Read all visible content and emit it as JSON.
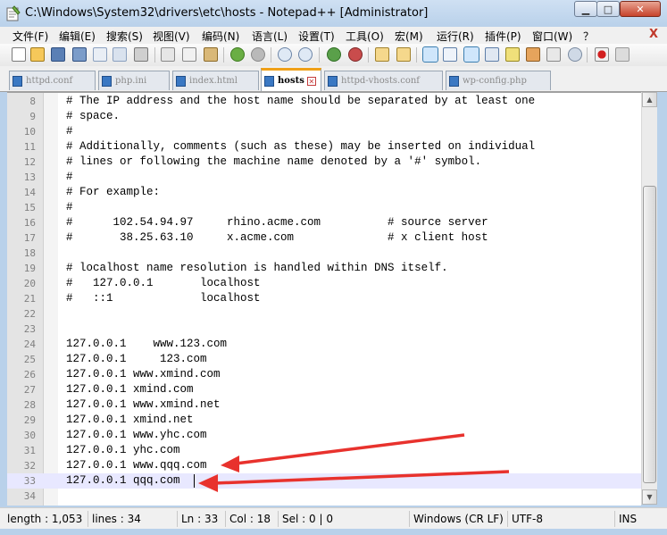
{
  "window": {
    "title": "C:\\Windows\\System32\\drivers\\etc\\hosts - Notepad++ [Administrator]",
    "minimize_glyph": "▁",
    "maximize_glyph": "□",
    "close_glyph": "✕"
  },
  "menu": {
    "items": [
      "文件(F)",
      "编辑(E)",
      "搜索(S)",
      "视图(V)",
      "编码(N)",
      "语言(L)",
      "设置(T)",
      "工具(O)",
      "宏(M)",
      "运行(R)",
      "插件(P)",
      "窗口(W)",
      "？"
    ],
    "close_glyph": "X"
  },
  "toolbar": {
    "icons": [
      "new-file-icon",
      "open-file-icon",
      "save-icon",
      "save-all-icon",
      "close-icon",
      "close-all-icon",
      "print-icon",
      "cut-icon",
      "copy-icon",
      "paste-icon",
      "undo-icon",
      "redo-icon",
      "find-icon",
      "replace-icon",
      "zoom-in-icon",
      "zoom-out-icon",
      "sync-vertical-icon",
      "sync-horizontal-icon",
      "word-wrap-icon",
      "show-all-chars-icon",
      "indent-guide-icon",
      "doc-map-icon",
      "function-list-icon",
      "folder-workspace-icon",
      "monitor-icon",
      "record-macro-icon",
      "stop-record-icon"
    ]
  },
  "tabs": [
    {
      "label": "httpd.conf",
      "active": false
    },
    {
      "label": "php.ini",
      "active": false
    },
    {
      "label": "index.html",
      "active": false
    },
    {
      "label": "hosts",
      "active": true
    },
    {
      "label": "httpd-vhosts.conf",
      "active": false
    },
    {
      "label": "wp-config.php",
      "active": false
    }
  ],
  "editor": {
    "first_line": 8,
    "current_line": 33,
    "lines": [
      "# The IP address and the host name should be separated by at least one",
      "# space.",
      "#",
      "# Additionally, comments (such as these) may be inserted on individual",
      "# lines or following the machine name denoted by a '#' symbol.",
      "#",
      "# For example:",
      "#",
      "#      102.54.94.97     rhino.acme.com          # source server",
      "#       38.25.63.10     x.acme.com              # x client host",
      "",
      "# localhost name resolution is handled within DNS itself.",
      "#   127.0.0.1       localhost",
      "#   ::1             localhost",
      "",
      "",
      "127.0.0.1    www.123.com",
      "127.0.0.1     123.com",
      "127.0.0.1 www.xmind.com",
      "127.0.0.1 xmind.com",
      "127.0.0.1 www.xmind.net",
      "127.0.0.1 xmind.net",
      "127.0.0.1 www.yhc.com",
      "127.0.0.1 yhc.com",
      "127.0.0.1 www.qqq.com",
      "127.0.0.1 qqq.com",
      ""
    ]
  },
  "annotations": {
    "arrow_color": "#e8322d"
  },
  "scrollbar": {
    "up_glyph": "▲",
    "down_glyph": "▼"
  },
  "status": {
    "length": "length : 1,053",
    "lines": "lines : 34",
    "ln": "Ln : 33",
    "col": "Col : 18",
    "sel": "Sel : 0 | 0",
    "eol": "Windows (CR LF)",
    "encoding": "UTF-8",
    "mode": "INS"
  }
}
